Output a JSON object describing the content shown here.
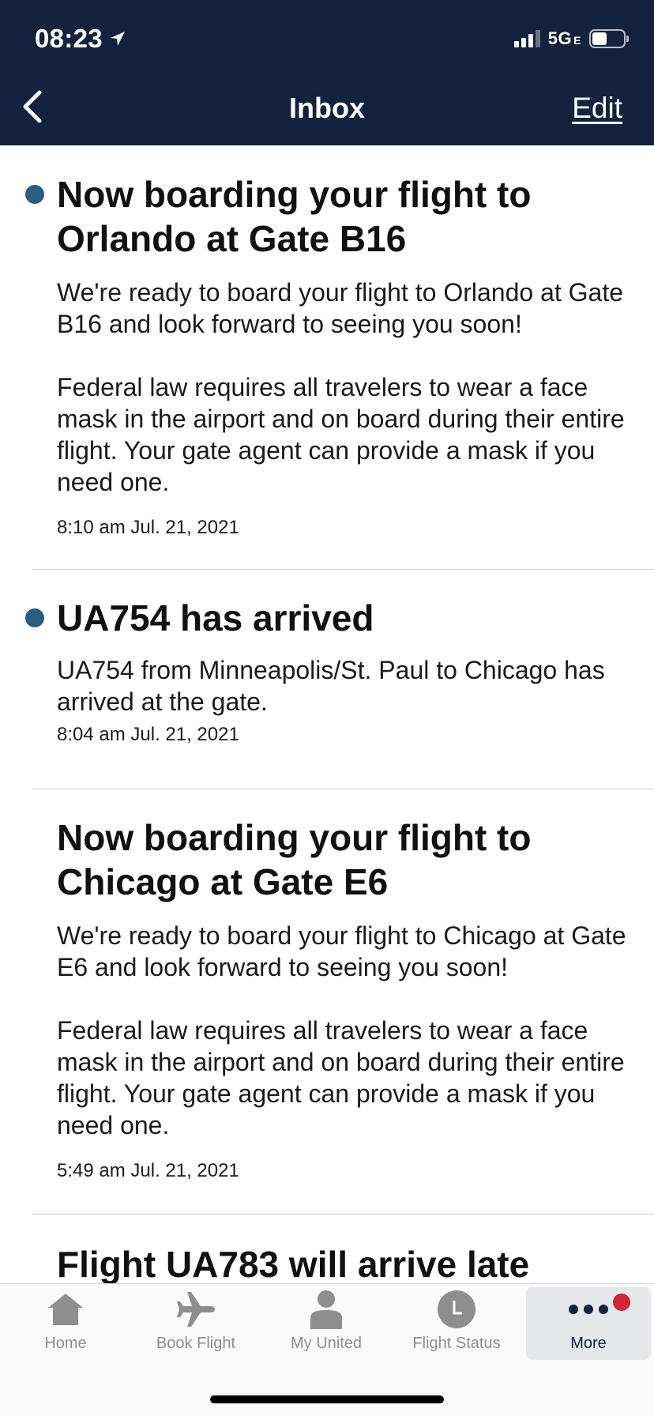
{
  "status_bar": {
    "time": "08:23",
    "network": "5G",
    "network_suffix": "E"
  },
  "header": {
    "title": "Inbox",
    "edit_label": "Edit"
  },
  "messages": [
    {
      "unread": true,
      "title": "Now boarding your flight to Orlando at Gate B16",
      "body": "We're ready to board your flight to Orlando at Gate B16 and look forward to seeing you soon!\n\nFederal law requires all travelers to wear a face mask in the airport and on board during their entire flight. Your gate agent can provide a mask if you need one.",
      "time": "8:10 am Jul. 21, 2021"
    },
    {
      "unread": true,
      "title": "UA754 has arrived",
      "body": "UA754 from Minneapolis/St. Paul to Chicago has arrived at the gate.",
      "time": "8:04 am Jul. 21, 2021"
    },
    {
      "unread": false,
      "title": "Now boarding your flight to Chicago at Gate E6",
      "body": "We're ready to board your flight to Chicago at Gate E6 and look forward to seeing you soon!\n\nFederal law requires all travelers to wear a face mask in the airport and on board during their entire flight. Your gate agent can provide a mask if you need one.",
      "time": "5:49 am Jul. 21, 2021"
    },
    {
      "unread": false,
      "title": "Flight UA783 will arrive late"
    }
  ],
  "tabbar": {
    "items": [
      {
        "label": "Home",
        "icon": "home-icon"
      },
      {
        "label": "Book Flight",
        "icon": "airplane-icon"
      },
      {
        "label": "My United",
        "icon": "person-icon"
      },
      {
        "label": "Flight Status",
        "icon": "clock-icon"
      },
      {
        "label": "More",
        "icon": "more-dots-icon",
        "active": true,
        "badge": true
      }
    ]
  },
  "colors": {
    "header_bg": "#13223d",
    "unread_dot": "#2a5d80",
    "badge": "#d32336"
  }
}
